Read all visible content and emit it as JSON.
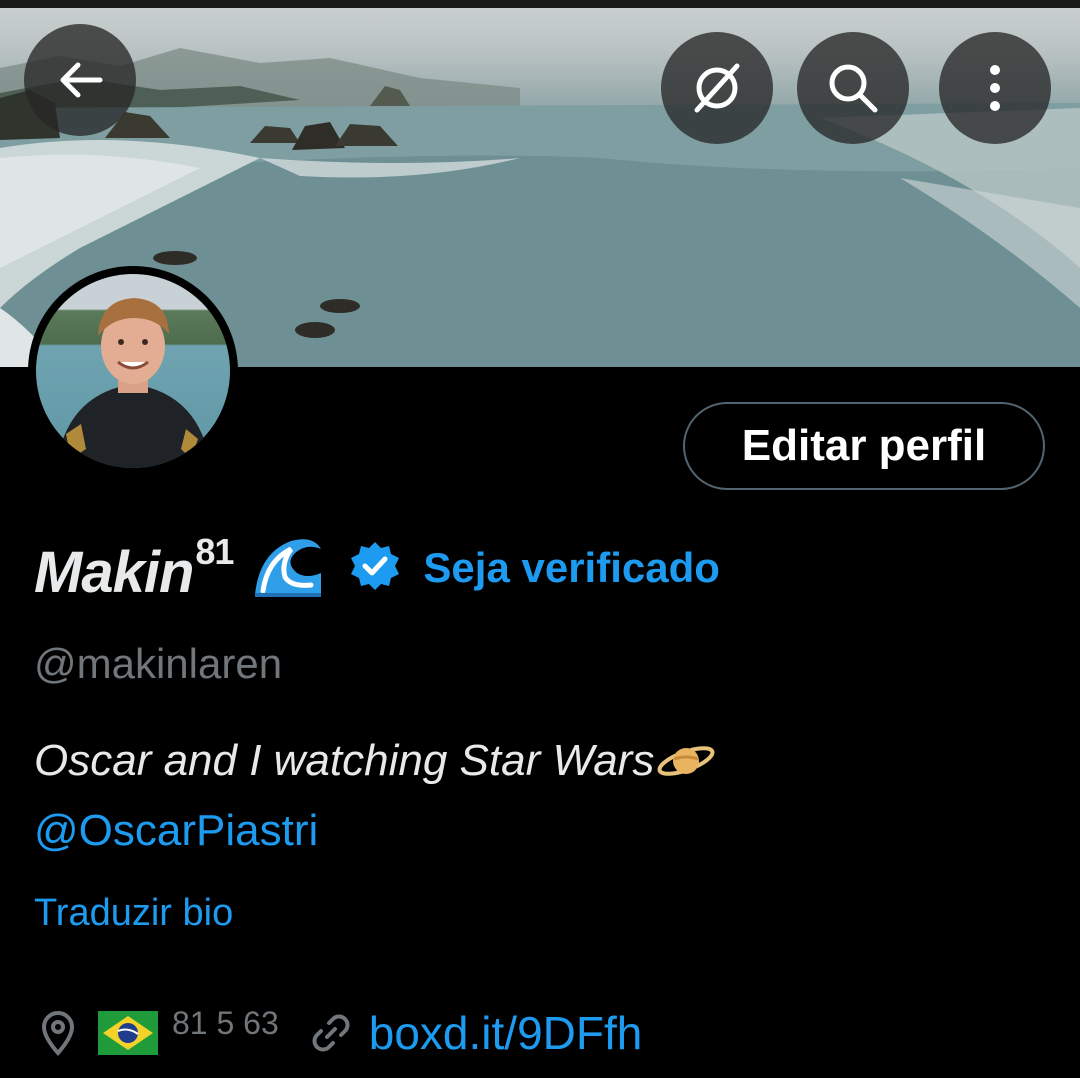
{
  "header": {
    "back_icon": "arrow-left-icon",
    "grok_icon": "slashed-circle-icon",
    "search_icon": "search-icon",
    "more_icon": "more-vertical-icon"
  },
  "profile": {
    "display_name": "Makin",
    "display_name_sup": "81",
    "name_emoji": "wave-emoji",
    "verified_icon": "verified-badge-icon",
    "verify_link": "Seja verificado",
    "handle": "@makinlaren",
    "bio_text": "Oscar and I watching Star Wars",
    "bio_emoji": "ringed-planet-emoji",
    "bio_mention": "@OscarPiastri",
    "translate_bio": "Traduzir bio",
    "location_icon": "location-pin-icon",
    "location_flag": "brazil-flag",
    "location_text": "81 5 63",
    "link_icon": "link-icon",
    "website": "boxd.it/9DFfh"
  },
  "actions": {
    "edit_profile": "Editar perfil"
  },
  "colors": {
    "accent": "#1d9bf0",
    "muted": "#71767b",
    "border": "#536471",
    "background": "#000000"
  }
}
